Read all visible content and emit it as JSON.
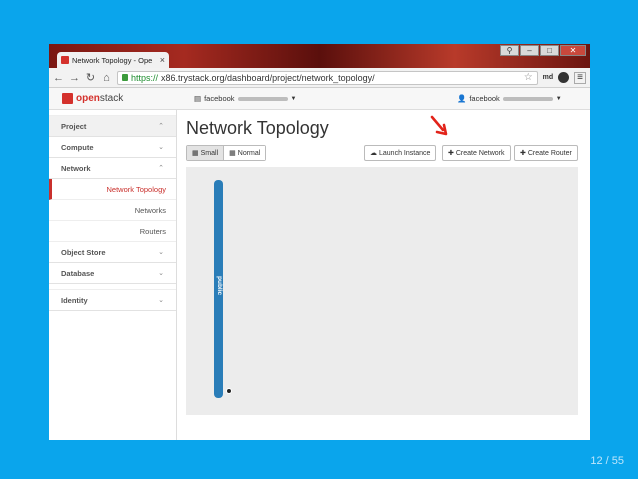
{
  "browser": {
    "tab_title": "Network Topology - Ope",
    "url_https": "https://",
    "url_rest": "x86.trystack.org/dashboard/project/network_topology/",
    "extension_label": "md"
  },
  "header": {
    "logo_text_a": "open",
    "logo_text_b": "stack",
    "project_label": "facebook",
    "user_label": "facebook"
  },
  "sidebar": {
    "sections": [
      {
        "label": "Project"
      },
      {
        "label": "Compute"
      },
      {
        "label": "Network"
      },
      {
        "label": "Object Store"
      },
      {
        "label": "Database"
      },
      {
        "label": "Identity"
      }
    ],
    "items": [
      {
        "label": "Network Topology",
        "active": true
      },
      {
        "label": "Networks"
      },
      {
        "label": "Routers"
      }
    ]
  },
  "main": {
    "title": "Network Topology",
    "view_small": "Small",
    "view_normal": "Normal",
    "launch_instance": "Launch Instance",
    "create_network": "Create Network",
    "create_router": "Create Router",
    "network_name": "public"
  },
  "slide": {
    "page_number": "12 / 55"
  },
  "colors": {
    "background": "#0aa5ec",
    "accent": "#c9302c",
    "network": "#2a7db8"
  }
}
